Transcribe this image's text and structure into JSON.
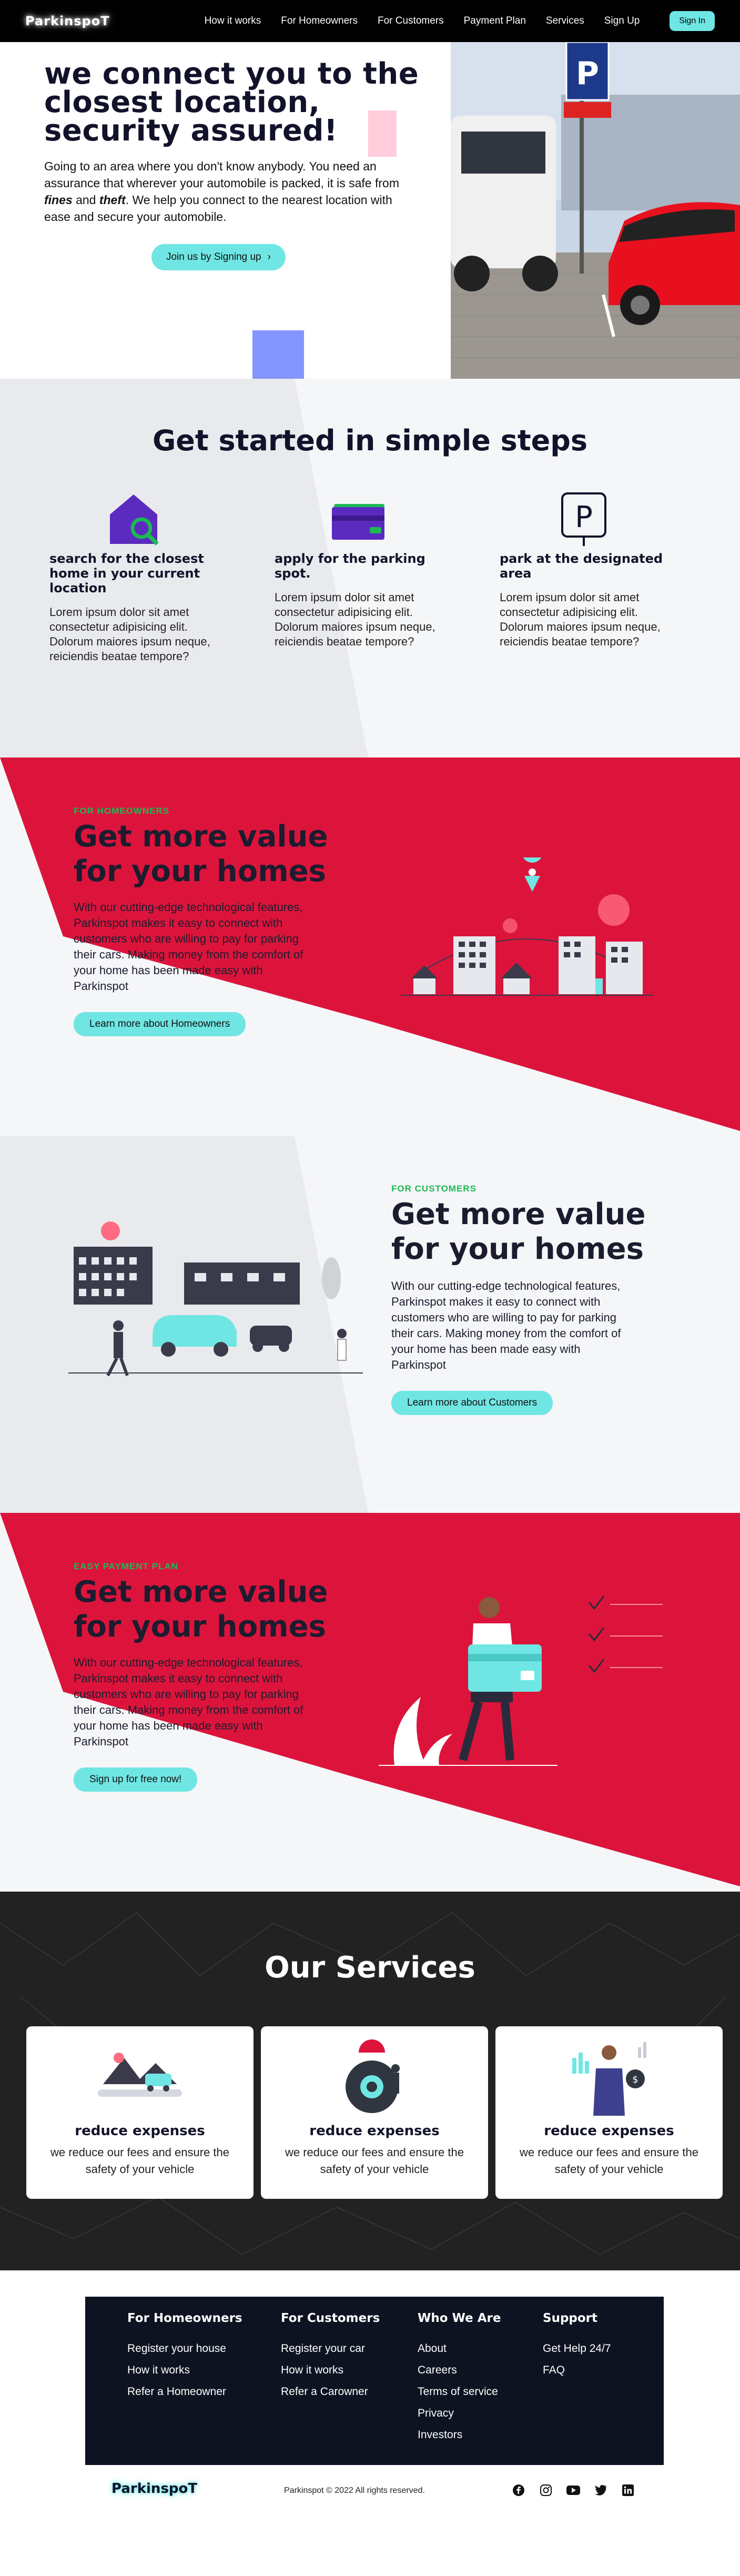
{
  "nav": {
    "logo": "ParkinspoT",
    "links": [
      "How it works",
      "For Homeowners",
      "For Customers",
      "Payment Plan",
      "Services",
      "Sign Up"
    ],
    "signin": "Sign In"
  },
  "hero": {
    "title": "we connect you to the closest location, security assured!",
    "text_before": "Going to an area where you don't know anybody. You need an assurance that wherever your automobile is packed, it is safe from ",
    "em1": "fines",
    "text_mid": " and ",
    "em2": "theft",
    "text_after": ". We help you connect to the nearest location with ease and secure your automobile.",
    "cta": "Join us by Signing up",
    "cta_icon": "›",
    "sign_letter": "P"
  },
  "steps": {
    "title": "Get started in simple steps",
    "items": [
      {
        "icon": "house-search-icon",
        "title": "search for the closest home in your current location",
        "text": "Lorem ipsum dolor sit amet consectetur adipisicing elit. Dolorum maiores ipsum neque, reiciendis beatae tempore?"
      },
      {
        "icon": "card-icon",
        "title": "apply for the parking spot.",
        "text": "Lorem ipsum dolor sit amet consectetur adipisicing elit. Dolorum maiores ipsum neque, reiciendis beatae tempore?"
      },
      {
        "icon": "parking-icon",
        "title": "park at the designated area",
        "text": "Lorem ipsum dolor sit amet consectetur adipisicing elit. Dolorum maiores ipsum neque, reiciendis beatae tempore?"
      }
    ],
    "parking_letter": "P"
  },
  "homeowners": {
    "kicker": "FOR HOMEOWNERS",
    "title_line1": "Get more value",
    "title_line2": "for your homes",
    "text": "With our cutting-edge technological features, Parkinspot makes it easy to connect with customers who are willing to pay for parking their cars. Making money from the comfort of your home has been made easy with Parkinspot",
    "button": "Learn more about Homeowners"
  },
  "customers": {
    "kicker": "FOR CUSTOMERS",
    "title_line1": "Get more value",
    "title_line2": "for your homes",
    "text": "With our cutting-edge technological features, Parkinspot makes it easy to connect with customers who are willing to pay for parking their cars. Making money from the comfort of your home has been made easy with Parkinspot",
    "button": "Learn more about Customers"
  },
  "payment": {
    "kicker": "EASY PAYMENT PLAN",
    "title_line1": "Get more value",
    "title_line2": "for your homes",
    "text": "With our cutting-edge technological features, Parkinspot makes it easy to connect with customers who are willing to pay for parking their cars. Making money from the comfort of your home has been made easy with Parkinspot",
    "button": "Sign up for free now!"
  },
  "services": {
    "title": "Our Services",
    "cards": [
      {
        "title": "reduce expenses",
        "text": "we reduce our fees and ensure the safety of your vehicle"
      },
      {
        "title": "reduce expenses",
        "text": "we reduce our fees and ensure the safety of your vehicle"
      },
      {
        "title": "reduce expenses",
        "text": "we reduce our fees and ensure the safety of your vehicle"
      }
    ],
    "coin_symbol": "$"
  },
  "footer": {
    "cols": [
      {
        "title": "For Homeowners",
        "links": [
          "Register your house",
          "How it works",
          "Refer a Homeowner"
        ]
      },
      {
        "title": "For Customers",
        "links": [
          "Register your car",
          "How it works",
          "Refer a Carowner"
        ]
      },
      {
        "title": "Who We Are",
        "links": [
          "About",
          "Careers",
          "Terms of service",
          "Privacy",
          "Investors"
        ]
      },
      {
        "title": "Support",
        "links": [
          "Get Help 24/7",
          "FAQ"
        ]
      }
    ],
    "logo": "ParkinspoT",
    "copyright": "Parkinspot © 2022 All rights reserved.",
    "socials": [
      "facebook-icon",
      "instagram-icon",
      "youtube-icon",
      "twitter-icon",
      "linkedin-icon"
    ]
  },
  "colors": {
    "accent": "#6fe6e3",
    "red": "#dc143c",
    "navy": "#12122a",
    "purple": "#5b2bbf",
    "green": "#1db954"
  }
}
